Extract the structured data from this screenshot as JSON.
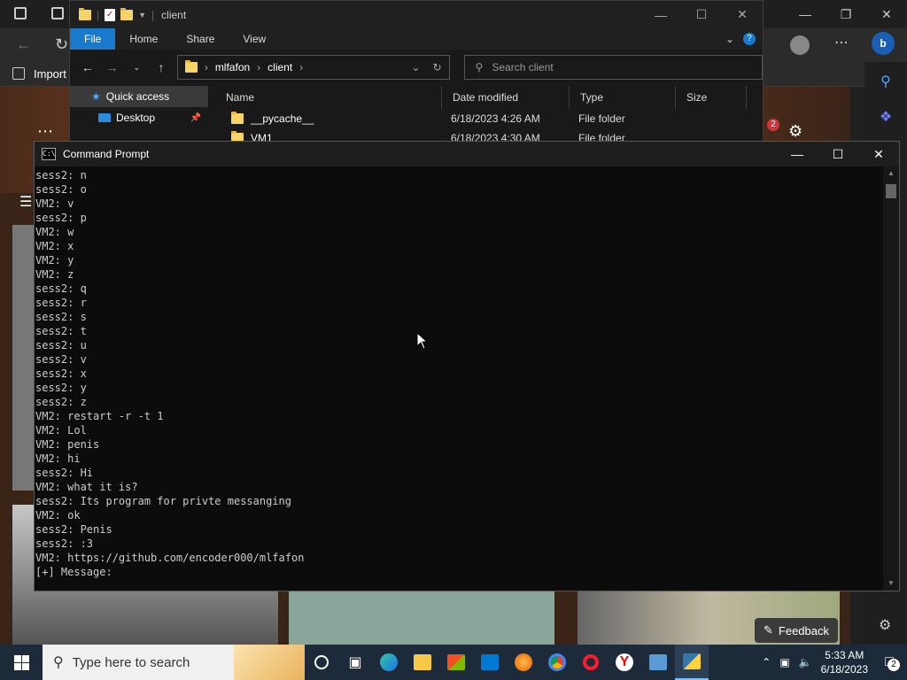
{
  "edge": {
    "import_label": "Import",
    "notification_count": "2",
    "feedback_label": "Feedback"
  },
  "explorer": {
    "title": "client",
    "ribbon_tabs": [
      "File",
      "Home",
      "Share",
      "View"
    ],
    "breadcrumb": [
      "mlfafon",
      "client"
    ],
    "search_placeholder": "Search client",
    "nav_items": [
      {
        "label": "Quick access",
        "icon": "star-icon"
      },
      {
        "label": "Desktop",
        "icon": "desktop-icon"
      }
    ],
    "columns": [
      "Name",
      "Date modified",
      "Type",
      "Size"
    ],
    "rows": [
      {
        "name": "__pycache__",
        "date": "6/18/2023 4:26 AM",
        "type": "File folder"
      },
      {
        "name": "VM1",
        "date": "6/18/2023 4:30 AM",
        "type": "File folder"
      }
    ]
  },
  "cmd": {
    "title": "Command Prompt",
    "lines": [
      "sess2: n",
      "sess2: o",
      "VM2: v",
      "sess2: p",
      "VM2: w",
      "VM2: x",
      "VM2: y",
      "VM2: z",
      "sess2: q",
      "sess2: r",
      "sess2: s",
      "sess2: t",
      "sess2: u",
      "sess2: v",
      "sess2: x",
      "sess2: y",
      "sess2: z",
      "VM2: restart -r -t 1",
      "VM2: Lol",
      "VM2: penis",
      "VM2: hi",
      "sess2: Hi",
      "VM2: what it is?",
      "sess2: Its program for privte messanging",
      "VM2: ok",
      "sess2: Penis",
      "sess2: :3",
      "VM2: https://github.com/encoder000/mlfafon",
      "[+] Message: "
    ]
  },
  "taskbar": {
    "search_placeholder": "Type here to search",
    "time": "5:33 AM",
    "date": "6/18/2023",
    "notification_badge": "2"
  }
}
